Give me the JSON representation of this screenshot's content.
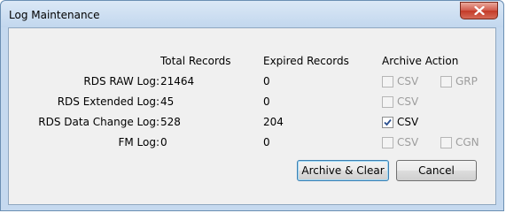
{
  "window": {
    "title": "Log Maintenance",
    "close_glyph": "x"
  },
  "table": {
    "headers": {
      "total": "Total Records",
      "expired": "Expired Records",
      "action": "Archive Action"
    },
    "rows": [
      {
        "label": "RDS RAW  Log:",
        "total": "21464",
        "expired": "0",
        "options": [
          {
            "label": "CSV",
            "checked": false,
            "enabled": false
          },
          {
            "label": "GRP",
            "checked": false,
            "enabled": false
          }
        ]
      },
      {
        "label": "RDS Extended Log:",
        "total": "45",
        "expired": "0",
        "options": [
          {
            "label": "CSV",
            "checked": false,
            "enabled": false
          }
        ]
      },
      {
        "label": "RDS Data Change Log:",
        "total": "528",
        "expired": "204",
        "options": [
          {
            "label": "CSV",
            "checked": true,
            "enabled": true
          }
        ]
      },
      {
        "label": "FM Log:",
        "total": "0",
        "expired": "0",
        "options": [
          {
            "label": "CSV",
            "checked": false,
            "enabled": false
          },
          {
            "label": "CGN",
            "checked": false,
            "enabled": false
          }
        ]
      }
    ]
  },
  "buttons": {
    "archive_clear": "Archive & Clear",
    "cancel": "Cancel"
  }
}
